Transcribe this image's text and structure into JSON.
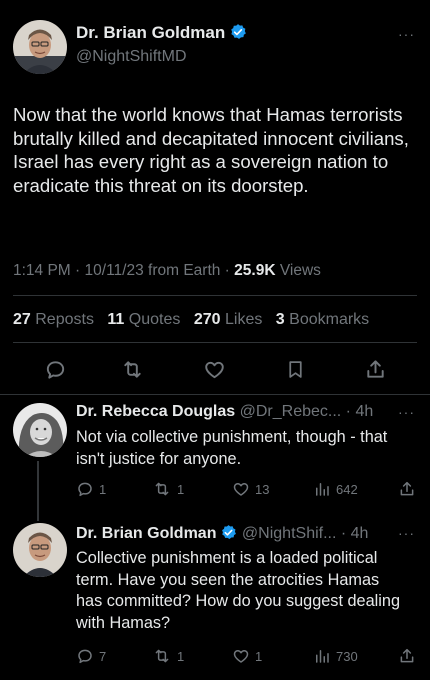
{
  "main_tweet": {
    "display_name": "Dr. Brian Goldman",
    "handle": "@NightShiftMD",
    "text": "Now that the world knows that Hamas terrorists brutally killed and decapitated innocent civilians, Israel has every right as a sovereign nation to eradicate this threat on its doorstep.",
    "time": "1:14 PM",
    "date": "10/11/23",
    "source": "from Earth",
    "views_count": "25.9K",
    "views_label": "Views",
    "reposts_count": "27",
    "reposts_label": "Reposts",
    "quotes_count": "11",
    "quotes_label": "Quotes",
    "likes_count": "270",
    "likes_label": "Likes",
    "bookmarks_count": "3",
    "bookmarks_label": "Bookmarks",
    "more": "···",
    "icons": [
      "reply-icon",
      "repost-icon",
      "like-icon",
      "bookmark-icon",
      "share-icon"
    ]
  },
  "replies": [
    {
      "display_name": "Dr. Rebecca Douglas",
      "handle": "@Dr_Rebec...",
      "age": "4h",
      "text": "Not via collective punishment, though - that isn't justice for anyone.",
      "reply_count": "1",
      "repost_count": "1",
      "like_count": "13",
      "view_count": "642",
      "more": "···"
    },
    {
      "display_name": "Dr. Brian Goldman",
      "handle": "@NightShif...",
      "age": "4h",
      "text": "Collective punishment is a loaded political term. Have you seen the atrocities Hamas has committed? How do you suggest dealing with Hamas?",
      "reply_count": "7",
      "repost_count": "1",
      "like_count": "1",
      "view_count": "730",
      "more": "···"
    }
  ],
  "colors": {
    "background": "#000000",
    "text": "#e7e9ea",
    "muted": "#71767b",
    "verified": "#1d9bf0",
    "divider": "#2f3336"
  }
}
